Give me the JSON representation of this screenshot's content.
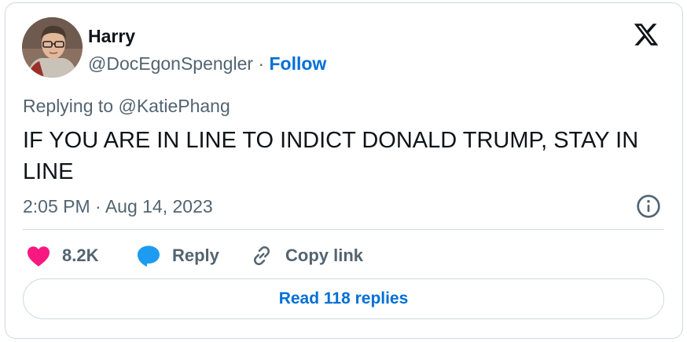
{
  "author": {
    "display_name": "Harry",
    "handle": "@DocEgonSpengler",
    "separator": "·",
    "follow_label": "Follow"
  },
  "brand_logo": "x-logo-icon",
  "reply_context": {
    "prefix": "Replying to",
    "mention": "@KatiePhang"
  },
  "tweet": {
    "text": "IF YOU ARE IN LINE TO INDICT DONALD TRUMP, STAY IN LINE",
    "timestamp": "2:05 PM · Aug 14, 2023"
  },
  "actions": {
    "like_count": "8.2K",
    "reply_label": "Reply",
    "copy_label": "Copy link"
  },
  "read_replies_label": "Read 118 replies",
  "colors": {
    "link": "#006fd6",
    "like": "#f91880",
    "reply_icon": "#1d9bf0",
    "secondary_text": "#536471",
    "border": "#cfd9de"
  }
}
